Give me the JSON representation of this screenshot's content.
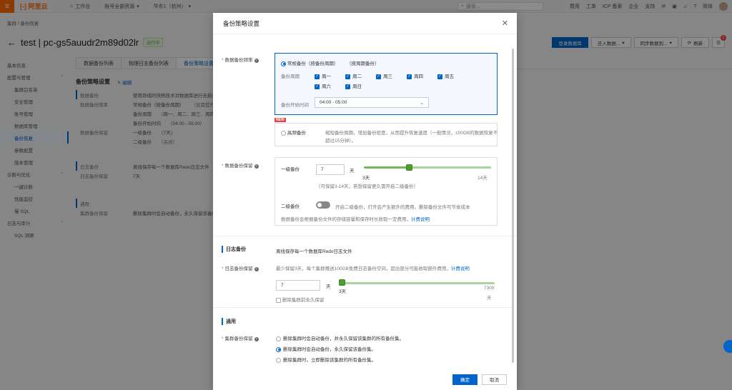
{
  "topbar": {
    "workbench": "工作台",
    "account": "账号全部资源",
    "region": "华东1（杭州）",
    "search_placeholder": "搜索...",
    "links": [
      "费用",
      "工单",
      "ICP 备案",
      "企业",
      "支持"
    ],
    "lang": "简体"
  },
  "breadcrumb": "集群  /  备份恢复",
  "page": {
    "title": "test | pc-gs5auudr2m89d02lr",
    "status": "运行中",
    "actions": [
      "登录数据库",
      "迁入数据...",
      "同步数据到...",
      "刷新"
    ],
    "badge": "1"
  },
  "leftnav": [
    {
      "label": "基本信息",
      "sub": false
    },
    {
      "label": "配置与管理",
      "sub": false,
      "chev": "^"
    },
    {
      "label": "集群白名单",
      "sub": true
    },
    {
      "label": "安全管理",
      "sub": true
    },
    {
      "label": "账号管理",
      "sub": true
    },
    {
      "label": "数据库管理",
      "sub": true
    },
    {
      "label": "备份恢复",
      "sub": true,
      "active": true
    },
    {
      "label": "参数配置",
      "sub": true
    },
    {
      "label": "版本管理",
      "sub": true
    },
    {
      "label": "诊断与优化",
      "sub": false,
      "chev": "^"
    },
    {
      "label": "一键诊断",
      "sub": true
    },
    {
      "label": "性能监控",
      "sub": true
    },
    {
      "label": "慢 SQL",
      "sub": true
    },
    {
      "label": "日志与审计",
      "sub": false,
      "chev": "^"
    },
    {
      "label": "SQL 洞察",
      "sub": true
    }
  ],
  "main": {
    "tabs": [
      "数据备份列表",
      "物理日志备份列表",
      "备份策略设置"
    ],
    "section_title": "备份策略设置",
    "edit": "编辑",
    "data_backup": "数据备份",
    "data_backup_desc": "使用存储的快照技术对数据库进行无损备份",
    "freq_label": "数据备份频率",
    "freq_value": "常规备份（按备份周期）",
    "freq_note": "（加需提升备份频",
    "period_label": "备份周期",
    "period_value": "（周一、周二、周三、周四、周五",
    "start_label": "备份开始时间",
    "start_value": "（04:00 - 05:00）",
    "retain_label": "数据备份保留",
    "l1": "一级备份",
    "l1_val": "（7天）",
    "l2": "二级备份",
    "l2_val": "（关闭）",
    "log_backup": "日志备份",
    "log_desc": "离线保存每一个数据库Redo日志文件",
    "log_retain_label": "日志备份保留",
    "log_retain_val": "7天",
    "general": "通用",
    "cluster_retain_label": "集群备份保留",
    "cluster_retain_val": "删除集群时会自动备份，永久保留该备份集。"
  },
  "modal": {
    "title": "备份策略设置",
    "freq_label": "数据备份频率",
    "regular": "常规备份（按备份周期）",
    "regular_note": "（按周期备份）",
    "period_label": "备份周期",
    "days": [
      {
        "label": "周一",
        "checked": true
      },
      {
        "label": "周二",
        "checked": true
      },
      {
        "label": "周三",
        "checked": true
      },
      {
        "label": "周四",
        "checked": true
      },
      {
        "label": "周五",
        "checked": true
      },
      {
        "label": "周六",
        "checked": true
      },
      {
        "label": "周日",
        "checked": true
      }
    ],
    "start_label": "备份开始时间",
    "start_value": "04:00 - 05:00",
    "new_tag": "NEW",
    "hf": "高频备份",
    "hf_desc1": "缩短备份周期，增加备份密度，从而提升恢复速度（一般情况，100GB的数据恢复不",
    "hf_desc2": "超过15分钟）。",
    "retain_label": "数据备份保留",
    "l1_label": "一级备份",
    "l1_value": "7",
    "unit_day": "天",
    "l1_min": "3天",
    "l1_max": "14天",
    "l1_hint": "（可保留3-14天，若想保留更久需开启二级备份）",
    "l2_label": "二级备份",
    "l2_on": false,
    "l2_hint": "开启二级备份，打开会产生额外的费用，删除备份文件可节省成本",
    "billing_note": "数据备份会根据备份文件的存储容量和保存时长收取一定费用，",
    "billing_link": "计费说明",
    "log_section": "日志备份",
    "log_desc": "离线保存每一个数据库Redo日志文件",
    "log_retain_label": "日志备份保留",
    "log_retain_hint": "最少保留3天，每个集群赠送100GB免费日志备份空间，超出部分可能收取额外费用，",
    "log_retain_link": "计费说明",
    "log_value": "7",
    "log_min": "3天",
    "log_max": "7300",
    "log_max_unit": "天",
    "log_keep_forever": "删除集群前永久保留",
    "general": "通用",
    "cluster_label": "集群备份保留",
    "cluster_options": [
      {
        "label": "删除集群时会自动备份，并永久保留该集群的所有备份集。",
        "on": false
      },
      {
        "label": "删除集群时会自动备份，永久保留该备份集。",
        "on": true
      },
      {
        "label": "删除集群时，立即删除该集群的所有备份集。",
        "on": false
      }
    ],
    "ok": "确定",
    "cancel": "取消",
    "l1_level": 0.36,
    "log_level": 0.0
  }
}
